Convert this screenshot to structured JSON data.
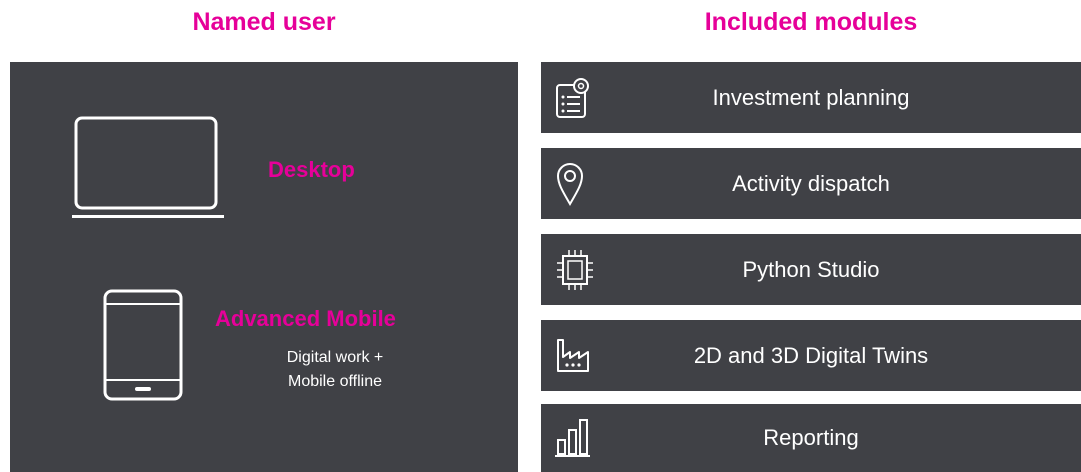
{
  "headings": {
    "left": "Named user",
    "right": "Included modules"
  },
  "named_user": {
    "desktop_label": "Desktop",
    "advanced_mobile_label": "Advanced Mobile",
    "advanced_mobile_lines": [
      "Digital work +",
      "Mobile offline"
    ]
  },
  "modules": [
    {
      "label": "Investment planning",
      "icon": "planning-gear-icon"
    },
    {
      "label": "Activity dispatch",
      "icon": "location-pin-icon"
    },
    {
      "label": "Python Studio",
      "icon": "chip-icon"
    },
    {
      "label": "2D and 3D Digital Twins",
      "icon": "factory-icon"
    },
    {
      "label": "Reporting",
      "icon": "bar-chart-icon"
    }
  ],
  "colors": {
    "accent": "#e60099",
    "panel": "#404146",
    "text_light": "#ffffff",
    "background": "#ffffff"
  }
}
